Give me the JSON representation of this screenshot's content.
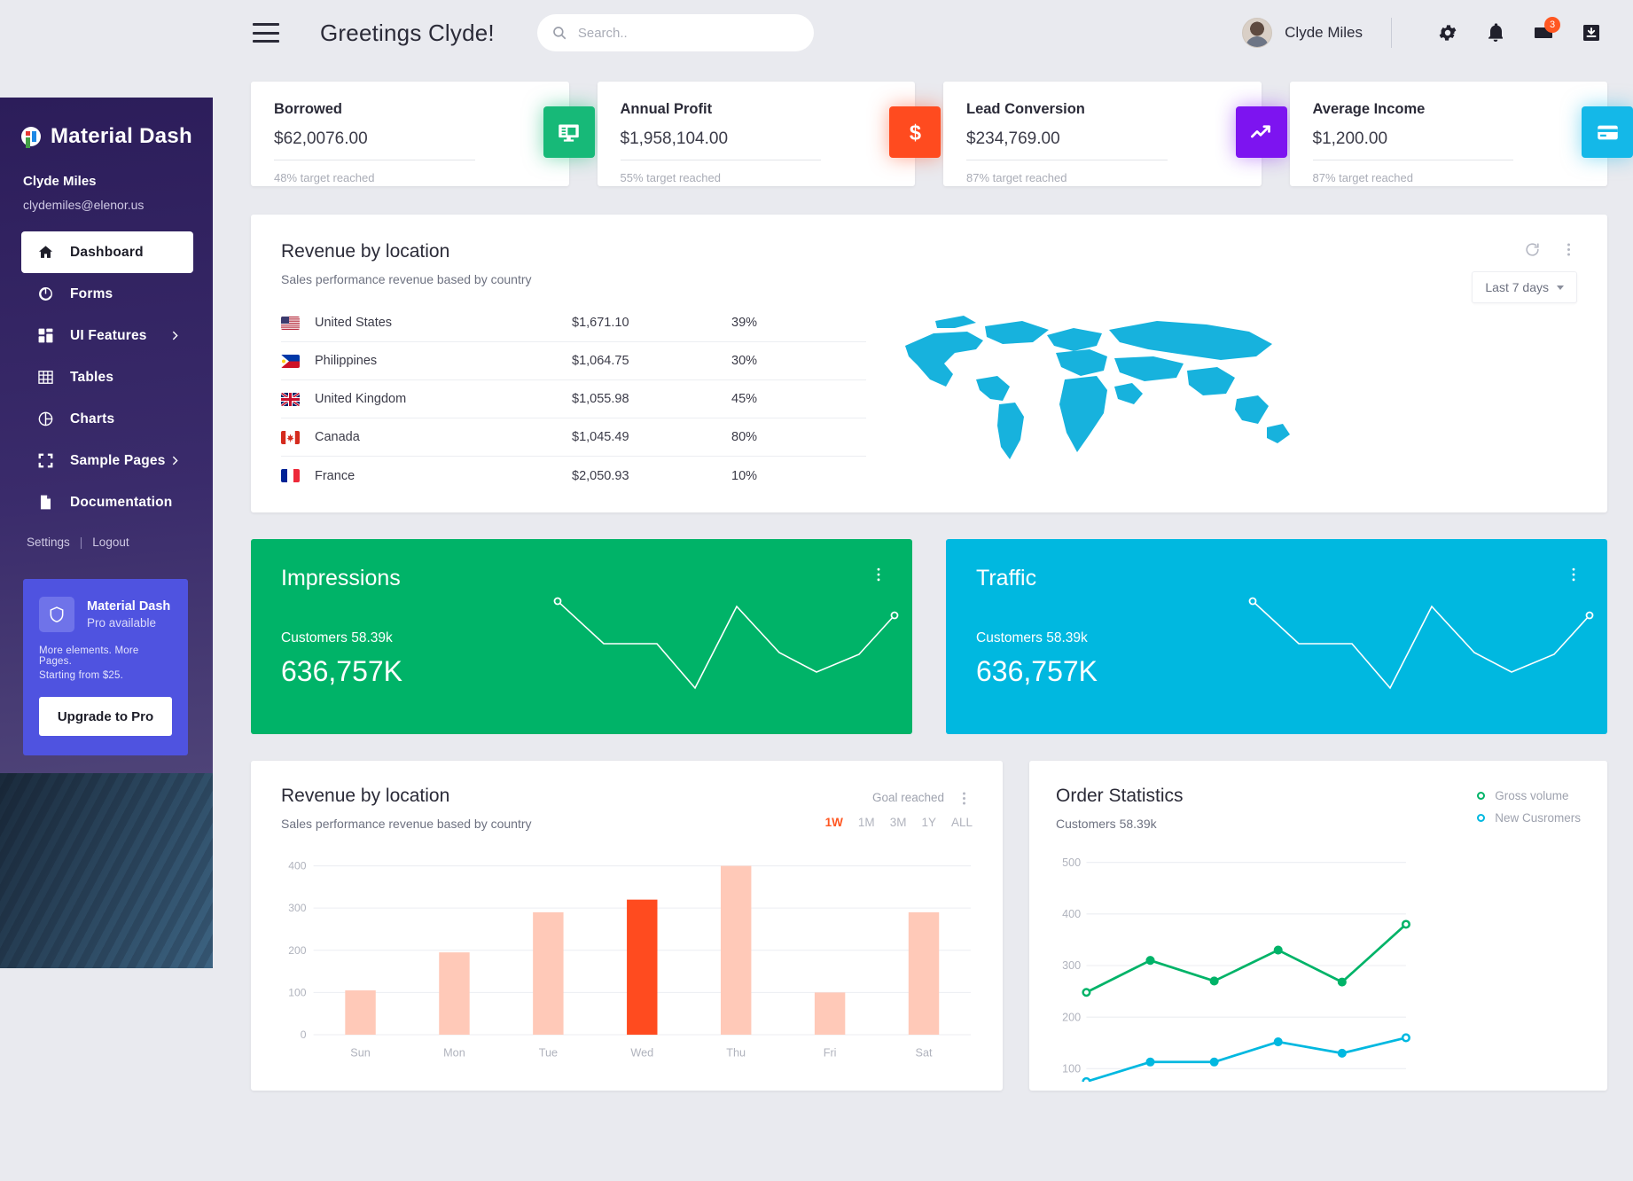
{
  "header": {
    "greeting": "Greetings Clyde!",
    "search_placeholder": "Search..",
    "user_name": "Clyde Miles",
    "mail_badge": "3",
    "icons": [
      "menu-icon",
      "search-icon",
      "gear-icon",
      "bell-icon",
      "mail-icon",
      "download-icon"
    ]
  },
  "sidebar": {
    "brand": "Material Dash",
    "user_name": "Clyde Miles",
    "user_email": "clydemiles@elenor.us",
    "items": [
      {
        "label": "Dashboard",
        "icon": "home-icon",
        "active": true,
        "expandable": false
      },
      {
        "label": "Forms",
        "icon": "forms-icon",
        "active": false,
        "expandable": false
      },
      {
        "label": "UI Features",
        "icon": "grid-icon",
        "active": false,
        "expandable": true
      },
      {
        "label": "Tables",
        "icon": "table-icon",
        "active": false,
        "expandable": false
      },
      {
        "label": "Charts",
        "icon": "pie-chart-icon",
        "active": false,
        "expandable": false
      },
      {
        "label": "Sample Pages",
        "icon": "pages-icon",
        "active": false,
        "expandable": true
      },
      {
        "label": "Documentation",
        "icon": "document-icon",
        "active": false,
        "expandable": false
      }
    ],
    "settings_label": "Settings",
    "logout_label": "Logout",
    "promo": {
      "title": "Material Dash",
      "subtitle": "Pro available",
      "line1": "More elements. More Pages.",
      "line2": "Starting from $25.",
      "button": "Upgrade to Pro"
    }
  },
  "stats": [
    {
      "title": "Borrowed",
      "value": "$62,0076.00",
      "sub": "48% target reached",
      "icon": "monitor-icon",
      "color": "#17b978"
    },
    {
      "title": "Annual Profit",
      "value": "$1,958,104.00",
      "sub": "55% target reached",
      "icon": "dollar-icon",
      "color": "#ff4b1f"
    },
    {
      "title": "Lead Conversion",
      "value": "$234,769.00",
      "sub": "87% target reached",
      "icon": "trending-up-icon",
      "color": "#7d14f0"
    },
    {
      "title": "Average Income",
      "value": "$1,200.00",
      "sub": "87% target reached",
      "icon": "card-icon",
      "color": "#14b8e8"
    }
  ],
  "revenue_card": {
    "title": "Revenue by location",
    "subtitle": "Sales performance revenue based by country",
    "dropdown": "Last 7 days",
    "rows": [
      {
        "country": "United States",
        "value": "$1,671.10",
        "percent": "39%"
      },
      {
        "country": "Philippines",
        "value": "$1,064.75",
        "percent": "30%"
      },
      {
        "country": "United Kingdom",
        "value": "$1,055.98",
        "percent": "45%"
      },
      {
        "country": "Canada",
        "value": "$1,045.49",
        "percent": "80%"
      },
      {
        "country": "France",
        "value": "$2,050.93",
        "percent": "10%"
      }
    ]
  },
  "impressions": {
    "title": "Impressions",
    "customers": "Customers 58.39k",
    "value": "636,757K",
    "color": "#00b368"
  },
  "traffic": {
    "title": "Traffic",
    "customers": "Customers 58.39k",
    "value": "636,757K",
    "color": "#00b8e0"
  },
  "bar_card": {
    "title": "Revenue by location",
    "subtitle": "Sales performance revenue based by country",
    "goal_label": "Goal reached",
    "ranges": [
      "1W",
      "1M",
      "3M",
      "1Y",
      "ALL"
    ],
    "active_range": "1W"
  },
  "order_card": {
    "title": "Order Statistics",
    "customers": "Customers 58.39k",
    "legend": [
      {
        "label": "Gross volume",
        "color": "#00b368"
      },
      {
        "label": "New Cusromers",
        "color": "#00b8e0"
      }
    ]
  },
  "chart_data": [
    {
      "type": "bar",
      "title": "Revenue by location",
      "categories": [
        "Sun",
        "Mon",
        "Tue",
        "Wed",
        "Thu",
        "Fri",
        "Sat"
      ],
      "values": [
        105,
        195,
        290,
        320,
        400,
        100,
        290
      ],
      "highlight_index": 3,
      "bar_color": "#ffc9b8",
      "highlight_color": "#ff4b1f",
      "ylim": [
        0,
        400
      ],
      "yticks": [
        0,
        100,
        200,
        300,
        400
      ],
      "xlabel": "",
      "ylabel": "",
      "grid": true
    },
    {
      "type": "line",
      "title": "Order Statistics",
      "x": [
        1,
        2,
        3,
        4,
        5,
        6
      ],
      "series": [
        {
          "name": "Gross volume",
          "values": [
            248,
            310,
            270,
            330,
            268,
            380
          ],
          "color": "#00b368"
        },
        {
          "name": "New Cusromers",
          "values": [
            75,
            113,
            113,
            152,
            130,
            160
          ],
          "color": "#00b8e0"
        }
      ],
      "ylim": [
        100,
        500
      ],
      "yticks": [
        100,
        200,
        300,
        400,
        500
      ],
      "grid": true,
      "legend_position": "top-right"
    },
    {
      "type": "line",
      "title": "Impressions",
      "values": [
        330,
        180,
        180,
        60,
        300,
        175,
        135,
        200,
        290
      ],
      "color": "#ffffff"
    },
    {
      "type": "line",
      "title": "Traffic",
      "values": [
        330,
        180,
        180,
        60,
        300,
        175,
        135,
        200,
        290
      ],
      "color": "#ffffff"
    }
  ]
}
